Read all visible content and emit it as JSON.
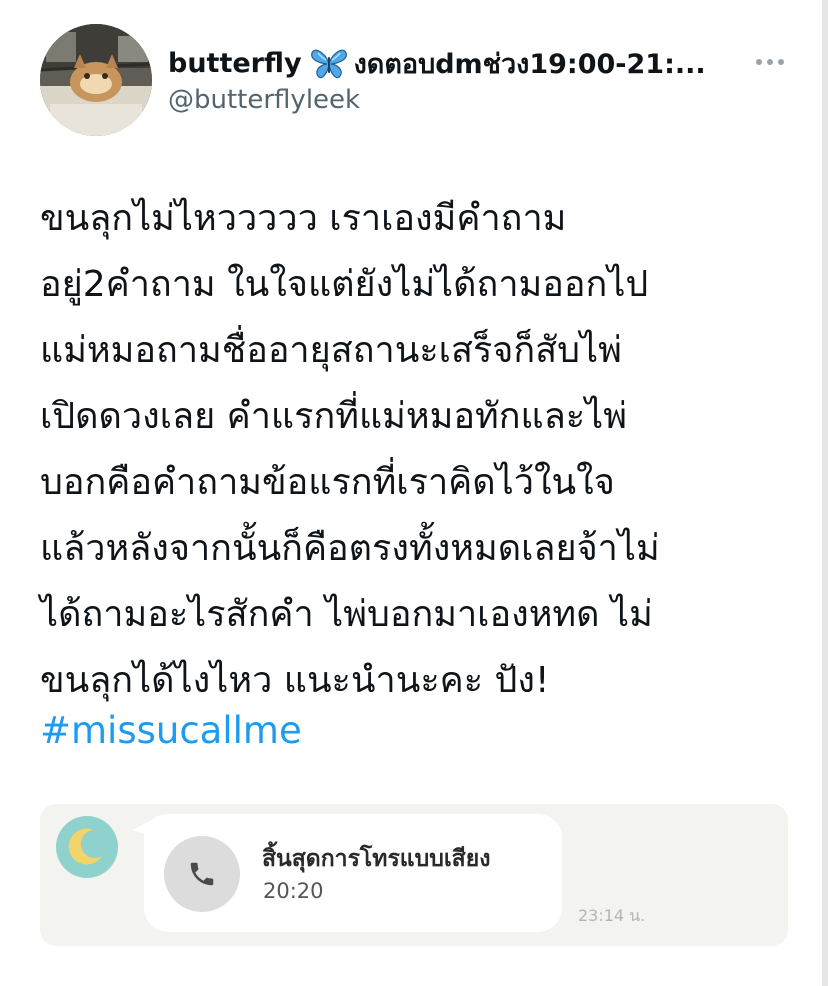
{
  "header": {
    "display_name": "butterfly",
    "display_name_suffix": "งดตอบdmช่วง19:00-21:...",
    "handle": "@butterflyleek"
  },
  "tweet": {
    "lines": [
      "ขนลุกไม่ไหววววว เราเองมีคำถาม",
      "อยู่2คำถาม ในใจแต่ยังไม่ได้ถามออกไป",
      "แม่หมอถามชื่ออายุสถานะเสร็จก็สับไพ่",
      "เปิดดวงเลย คำแรกที่แม่หมอทักและไพ่",
      "บอกคือคำถามข้อแรกที่เราคิดไว้ในใจ",
      "แล้วหลังจากนั้นก็คือตรงทั้งหมดเลยจ้าไม่",
      "ได้ถามอะไรสักคำ ไพ่บอกมาเองหทด ไม่",
      "ขนลุกได้ไงไหว แนะนำนะคะ ปัง!"
    ],
    "hashtag": "#missucallme"
  },
  "attachment": {
    "call_title": "สิ้นสุดการโทรแบบเสียง",
    "call_duration": "20:20",
    "message_time": "23:14 น."
  },
  "icons": {
    "butterfly": "butterfly-emoji-icon",
    "more": "more-options-icon",
    "phone": "phone-icon",
    "moon": "moon-icon"
  },
  "colors": {
    "hashtag": "#1d9bf0",
    "handle": "#536471",
    "text": "#0f1419",
    "moon_avatar_bg": "#8fd1cd",
    "moon": "#f3d46a",
    "card_bg": "#f3f3ef"
  }
}
